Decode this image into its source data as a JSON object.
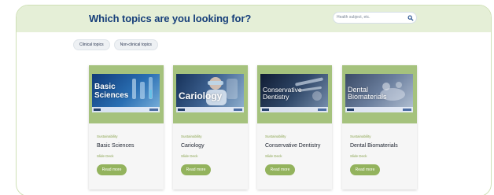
{
  "header": {
    "title": "Which topics are you looking for?",
    "search_placeholder": "Health subject, etc."
  },
  "filters": [
    {
      "label": "Clinical topics"
    },
    {
      "label": "Non-clinical topics"
    }
  ],
  "cards": [
    {
      "thumb_title_1": "Basic",
      "thumb_title_2": "Sciences",
      "category": "Sustainability",
      "title": "Basic Sciences",
      "type": "Slide Deck",
      "button": "Read more"
    },
    {
      "thumb_title_1": "Cariology",
      "thumb_title_2": "",
      "category": "Sustainability",
      "title": "Cariology",
      "type": "Slide Deck",
      "button": "Read more"
    },
    {
      "thumb_title_1": "Conservative",
      "thumb_title_2": "Dentistry",
      "category": "Sustainability",
      "title": "Conservative Dentistry",
      "type": "Slide Deck",
      "button": "Read more"
    },
    {
      "thumb_title_1": "Dental",
      "thumb_title_2": "Biomaterials",
      "category": "Sustainability",
      "title": "Dental Biomaterials",
      "type": "Slide Deck",
      "button": "Read more"
    }
  ],
  "colors": {
    "header_bg": "#e5efd7",
    "title": "#173f7a",
    "accent_green": "#93b35d",
    "thumb_frame": "#a5c27d"
  },
  "icons": {
    "search": "search-icon"
  }
}
